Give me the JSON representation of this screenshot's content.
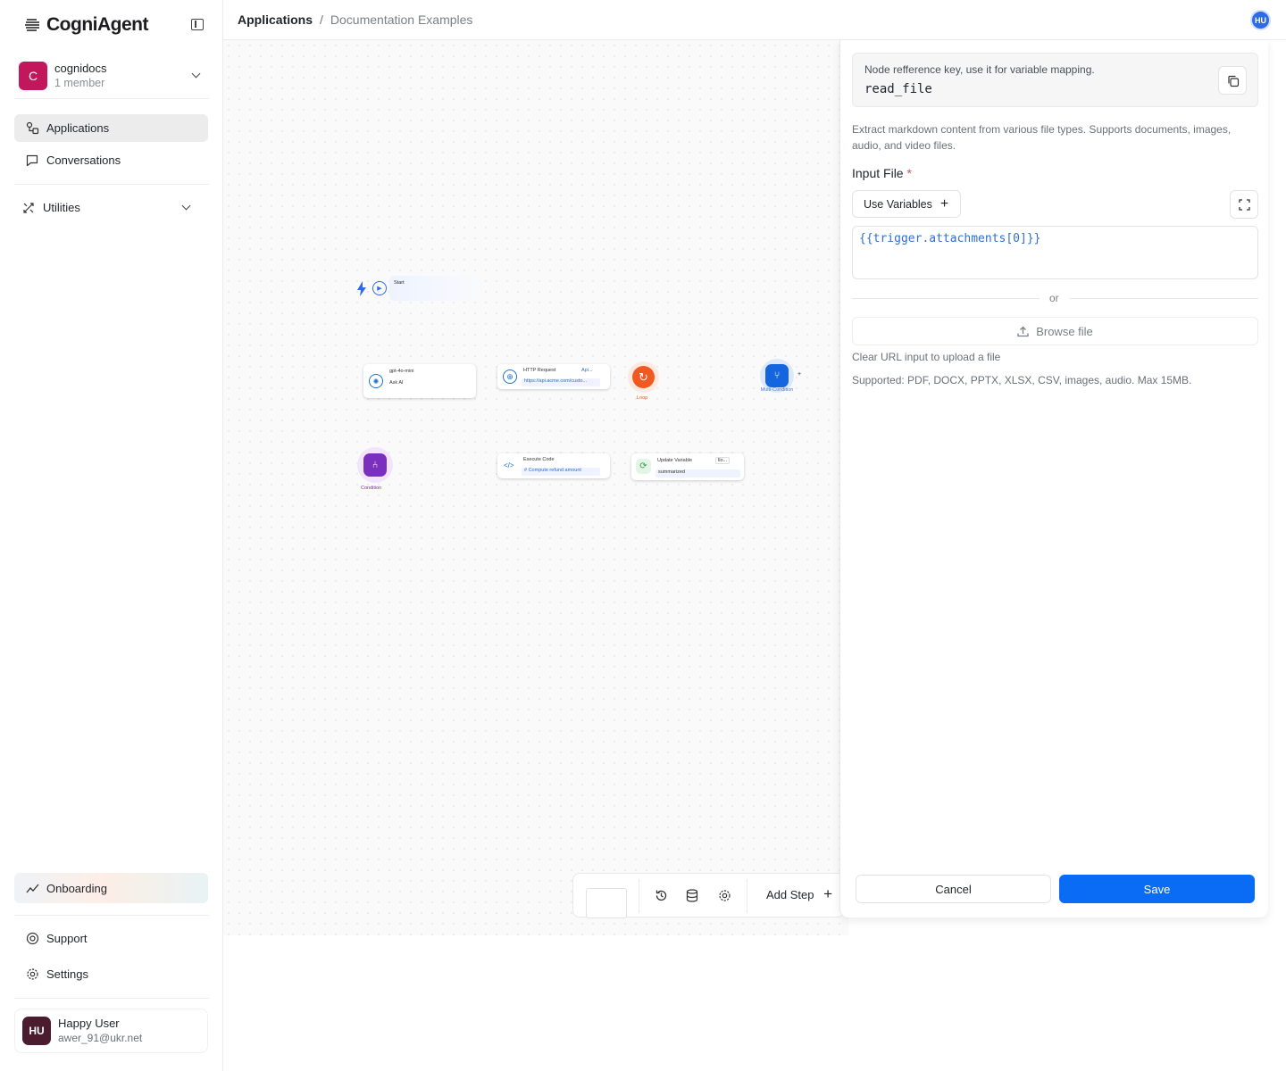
{
  "app": {
    "brand": "CogniAgent"
  },
  "workspace": {
    "name": "cognidocs",
    "members": "1 member",
    "initial": "C"
  },
  "nav": {
    "applications": "Applications",
    "conversations": "Conversations",
    "utilities": "Utilities",
    "onboarding": "Onboarding",
    "support": "Support",
    "settings": "Settings"
  },
  "user": {
    "initials": "HU",
    "name": "Happy User",
    "email": "awer_91@ukr.net"
  },
  "breadcrumb": {
    "root": "Applications",
    "separator": "/",
    "current": "Documentation Examples"
  },
  "canvas": {
    "nodes": {
      "start": "Start",
      "ask_model": "gpt-4o-mini",
      "ask_label": "Ask AI",
      "http_title": "HTTP Request",
      "http_badge": "Api...",
      "http_url": "https://api.acme.com/custo...",
      "loop": "Loop",
      "multi_condition": "Multi-Condition",
      "condition": "Condition",
      "exec_title": "Execute Code",
      "exec_sub": "# Compute refund amount",
      "update_title": "Update Variable",
      "update_badge": "llo...",
      "update_sub": "summarized"
    }
  },
  "toolbar": {
    "add_step": "Add Step"
  },
  "panel": {
    "ref_hint": "Node refference key, use it for variable mapping.",
    "ref_key": "read_file",
    "description": "Extract markdown content from various file types. Supports documents, images, audio, and video files.",
    "input_label": "Input File",
    "required_mark": "*",
    "use_variables": "Use Variables",
    "expression": "{{trigger.attachments[0]}}",
    "or": "or",
    "browse": "Browse file",
    "clear_note": "Clear URL input to upload a file",
    "supported_note": "Supported: PDF, DOCX, PPTX, XLSX, CSV, images, audio. Max 15MB.",
    "cancel": "Cancel",
    "save": "Save"
  },
  "colors": {
    "accent": "#0a6cf5",
    "workspace": "#c2185b",
    "user_avatar": "#4a1c2e",
    "loop": "#f05a22",
    "condition": "#7b2fbe"
  }
}
